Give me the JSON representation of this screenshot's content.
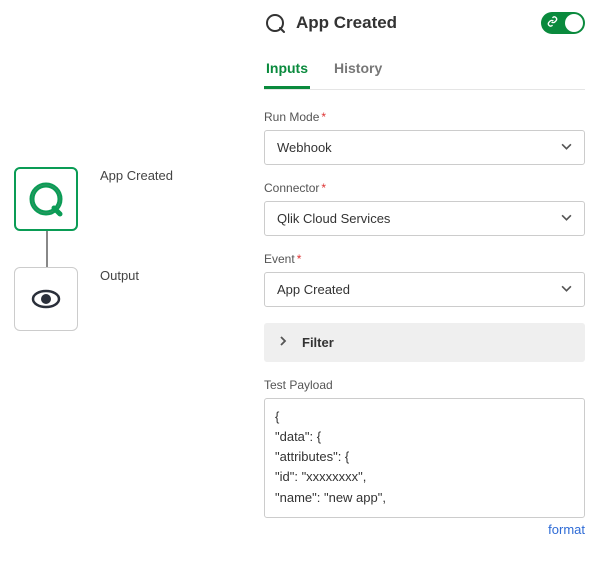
{
  "canvas": {
    "node1_label": "App Created",
    "node2_label": "Output"
  },
  "panel": {
    "title": "App Created",
    "tabs": {
      "inputs": "Inputs",
      "history": "History"
    },
    "fields": {
      "run_mode": {
        "label": "Run Mode",
        "value": "Webhook"
      },
      "connector": {
        "label": "Connector",
        "value": "Qlik Cloud Services"
      },
      "event": {
        "label": "Event",
        "value": "App Created"
      }
    },
    "filter_label": "Filter",
    "test_payload": {
      "label": "Test Payload",
      "text": "{\n\"data\": {\n\"attributes\": {\n\"id\": \"xxxxxxxx\",\n\"name\": \"new app\","
    },
    "format_link": "format"
  }
}
